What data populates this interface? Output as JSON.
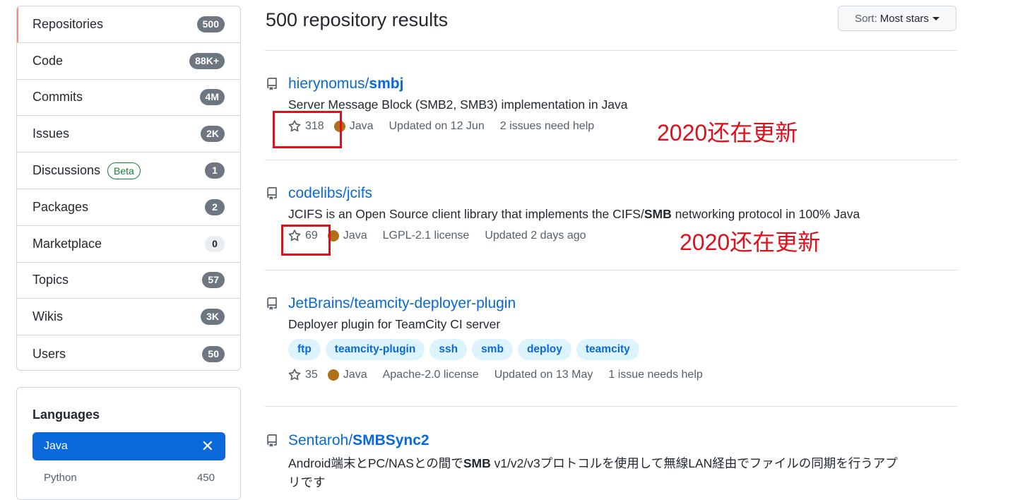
{
  "sidebar": {
    "filters": [
      {
        "label": "Repositories",
        "count": "500"
      },
      {
        "label": "Code",
        "count": "88K+"
      },
      {
        "label": "Commits",
        "count": "4M"
      },
      {
        "label": "Issues",
        "count": "2K"
      },
      {
        "label": "Discussions",
        "badge": "Beta",
        "count": "1"
      },
      {
        "label": "Packages",
        "count": "2"
      },
      {
        "label": "Marketplace",
        "count": "0"
      },
      {
        "label": "Topics",
        "count": "57"
      },
      {
        "label": "Wikis",
        "count": "3K"
      },
      {
        "label": "Users",
        "count": "50"
      }
    ],
    "languages": {
      "title": "Languages",
      "selected": "Java",
      "clear_icon": "x-icon",
      "other": {
        "name": "Python",
        "count": "450"
      }
    }
  },
  "main": {
    "results_title": "500 repository results",
    "sort": {
      "prefix": "Sort:",
      "value": "Most stars"
    },
    "repos": [
      {
        "owner": "hierynomus/",
        "name": "smbj",
        "description": "Server Message Block (SMB2, SMB3) implementation in Java",
        "stars": "318",
        "language": "Java",
        "updated": "Updated on 12 Jun",
        "extra": "2 issues need help"
      },
      {
        "owner": "codelibs/",
        "name": "jcifs",
        "desc_pre": "JCIFS is an Open Source client library that implements the CIFS/",
        "desc_bold": "SMB",
        "desc_post": " networking protocol in 100% Java",
        "stars": "69",
        "language": "Java",
        "license": "LGPL-2.1 license",
        "updated": "Updated 2 days ago"
      },
      {
        "full_name": "JetBrains/teamcity-deployer-plugin",
        "description": "Deployer plugin for TeamCity CI server",
        "topics": [
          "ftp",
          "teamcity-plugin",
          "ssh",
          "smb",
          "deploy",
          "teamcity"
        ],
        "stars": "35",
        "language": "Java",
        "license": "Apache-2.0 license",
        "updated": "Updated on 13 May",
        "extra": "1 issue needs help"
      },
      {
        "owner": "Sentaroh/",
        "name": "SMBSync2",
        "desc_pre": "Android端末とPC/NASとの間で",
        "desc_bold": "SMB",
        "desc_post": " v1/v2/v3プロトコルを使用して無線LAN経由でファイルの同期を行うアプ",
        "desc_line2": "リです"
      }
    ]
  },
  "annotations": [
    "2020还在更新",
    "2020还在更新"
  ],
  "colors": {
    "accent": "#0969da",
    "java": "#b07219",
    "annotation_red": "#e0101b",
    "selected_bar": "#fd8c73"
  }
}
